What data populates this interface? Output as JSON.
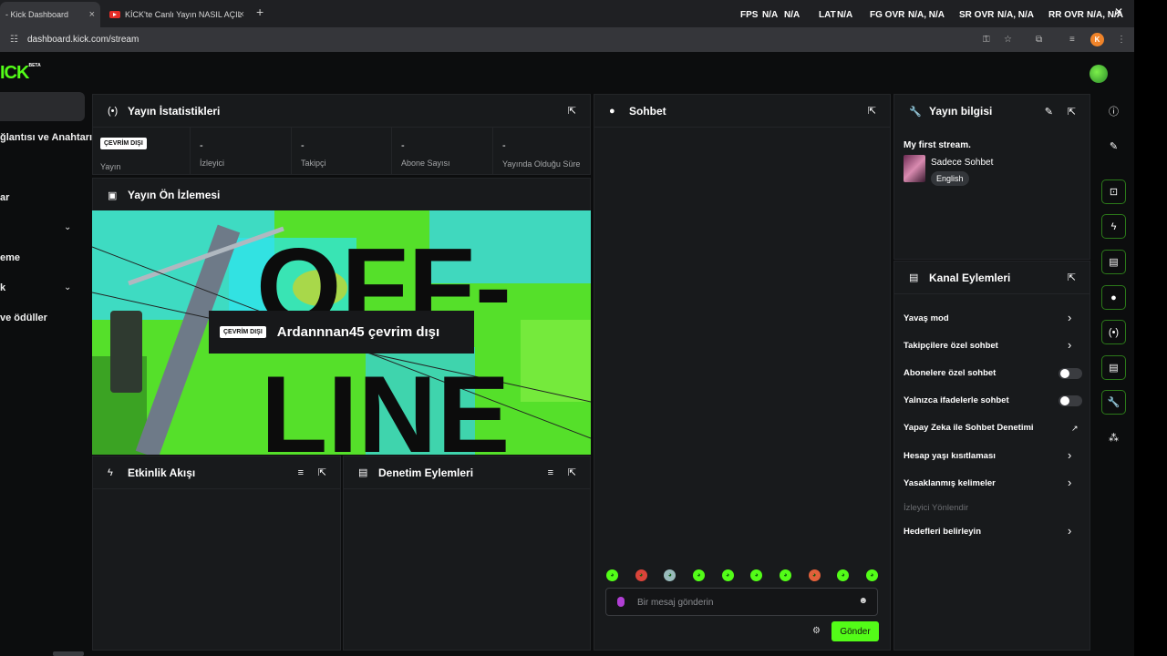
{
  "browser": {
    "tabs": [
      {
        "label": "- Kick Dashboard",
        "close": "×"
      },
      {
        "label": "KİCK'te Canlı Yayın NASIL AÇILIR",
        "close": "×"
      }
    ],
    "new_tab": "+",
    "url": "dashboard.kick.com/stream",
    "profile_letter": "K",
    "window_close": "✕"
  },
  "overlay": {
    "fps": "FPS",
    "fps_v1": "N/A",
    "fps_v2": "N/A",
    "lat": "LAT",
    "lat_v": "N/A",
    "fg": "FG OVR",
    "fg_v": "N/A, N/A",
    "sr": "SR OVR",
    "sr_v": "N/A, N/A",
    "rr": "RR OVR",
    "rr_v": "N/A, N/A"
  },
  "logo": {
    "text": "ICK",
    "beta": "BETA"
  },
  "leftnav": {
    "items": [
      {
        "label": "ğlantısı ve Anahtarı"
      },
      {
        "label": "ar"
      },
      {
        "label": ""
      },
      {
        "label": "eme"
      },
      {
        "label": "k"
      },
      {
        "label": "ve ödüller"
      }
    ]
  },
  "stats_panel": {
    "title": "Yayın İstatistikleri",
    "stream_status_badge": "ÇEVRİM DIŞI",
    "stream_label": "Yayın",
    "stats": [
      {
        "value": "-",
        "label": "İzleyici"
      },
      {
        "value": "-",
        "label": "Takipçi"
      },
      {
        "value": "-",
        "label": "Abone Sayısı"
      },
      {
        "value": "-",
        "label": "Yayında Olduğu Süre"
      }
    ]
  },
  "preview_panel": {
    "title": "Yayın Ön İzlemesi",
    "offline_badge": "ÇEVRİM DIŞI",
    "offline_text": "Ardannnan45 çevrim dışı",
    "art_text_top": "OFF-",
    "art_text_bottom": "LINE"
  },
  "activity_panel": {
    "title": "Etkinlik Akışı"
  },
  "moderation_panel": {
    "title": "Denetim Eylemleri"
  },
  "chat_panel": {
    "title": "Sohbet",
    "input_placeholder": "Bir mesaj gönderin",
    "send_label": "Gönder"
  },
  "stream_info": {
    "title": "Yayın bilgisi",
    "stream_title": "My first stream.",
    "category": "Sadece Sohbet",
    "language": "English"
  },
  "channel_actions": {
    "title": "Kanal Eylemleri",
    "items": [
      {
        "label": "Yavaş mod",
        "control": "arrow"
      },
      {
        "label": "Takipçilere özel sohbet",
        "control": "arrow"
      },
      {
        "label": "Abonelere özel sohbet",
        "control": "toggle",
        "on": false
      },
      {
        "label": "Yalnızca ifadelerle sohbet",
        "control": "toggle",
        "on": false
      },
      {
        "label": "Yapay Zeka ile Sohbet Denetimi",
        "control": "external"
      },
      {
        "label": "Hesap yaşı kısıtlaması",
        "control": "arrow"
      },
      {
        "label": "Yasaklanmış kelimeler",
        "control": "arrow"
      },
      {
        "label": "İzleyici Yönlendir",
        "control": "none",
        "disabled": true
      },
      {
        "label": "Hedefleri belirleyin",
        "control": "arrow"
      }
    ]
  },
  "colors": {
    "brand": "#53fc18",
    "panel": "#181a1c",
    "page": "#0c0d0e"
  }
}
